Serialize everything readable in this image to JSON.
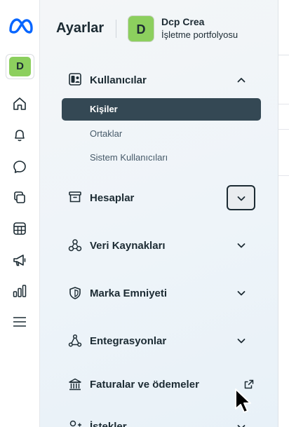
{
  "rail": {
    "logo": "meta-logo",
    "account_initial": "D",
    "icons": [
      "home-icon",
      "bell-icon",
      "chat-icon",
      "pages-icon",
      "table-icon",
      "megaphone-icon",
      "bar-chart-icon",
      "menu-icon"
    ]
  },
  "header": {
    "title": "Ayarlar",
    "business": {
      "initial": "D",
      "name": "Dcp Crea",
      "subtitle": "İşletme portfolyosu"
    }
  },
  "nav": {
    "users": {
      "label": "Kullanıcılar",
      "expanded": true,
      "items": [
        {
          "label": "Kişiler",
          "active": true
        },
        {
          "label": "Ortaklar",
          "active": false
        },
        {
          "label": "Sistem Kullanıcıları",
          "active": false
        }
      ]
    },
    "accounts": {
      "label": "Hesaplar"
    },
    "data_sources": {
      "label": "Veri Kaynakları"
    },
    "brand_safety": {
      "label": "Marka Emniyeti"
    },
    "integrations": {
      "label": "Entegrasyonlar"
    },
    "billing": {
      "label": "Faturalar ve ödemeler"
    },
    "requests": {
      "label": "İstekler"
    }
  },
  "colors": {
    "accent_dark": "#344854",
    "avatar_green": "#8ccf5e",
    "meta_blue": "#0866ff"
  }
}
